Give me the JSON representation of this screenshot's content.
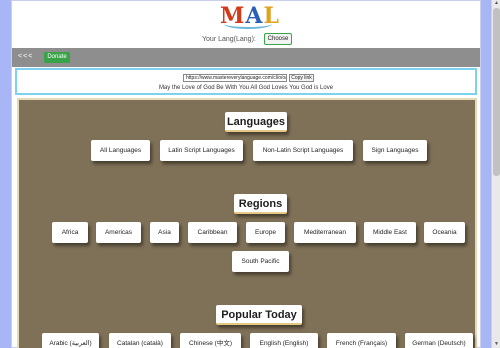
{
  "header": {
    "logo_letters": [
      "M",
      "A",
      "L"
    ],
    "lang_label": "Your Lang(Lang):",
    "choose_label": "Choose"
  },
  "toolbar": {
    "back_label": "<<<",
    "donate_label": "Donate"
  },
  "share": {
    "url": "https://www.mastereverylanguage.com/cl/o/o/h",
    "copy_label": "Copy link",
    "motto": "May the Love of God Be With You All God Loves You God is Love"
  },
  "languages": {
    "title": "Languages",
    "items": [
      "All Languages",
      "Latin Script Languages",
      "Non-Latin Script Languages",
      "Sign Languages"
    ]
  },
  "regions": {
    "title": "Regions",
    "items": [
      "Africa",
      "Americas",
      "Asia",
      "Caribbean",
      "Europe",
      "Mediterranean",
      "Middle East",
      "Oceania",
      "South Pacific"
    ]
  },
  "popular": {
    "title": "Popular Today",
    "items": [
      "Arabic (العربية)",
      "Catalan (català)",
      "Chinese (中文)",
      "English (English)",
      "French (Français)",
      "German (Deutsch)"
    ]
  },
  "colors": {
    "page_bg": "#a9b6f5",
    "content_bg": "#7f7157",
    "accent_green": "#3aa34a",
    "toolbar_gray": "#8e8e8e"
  }
}
